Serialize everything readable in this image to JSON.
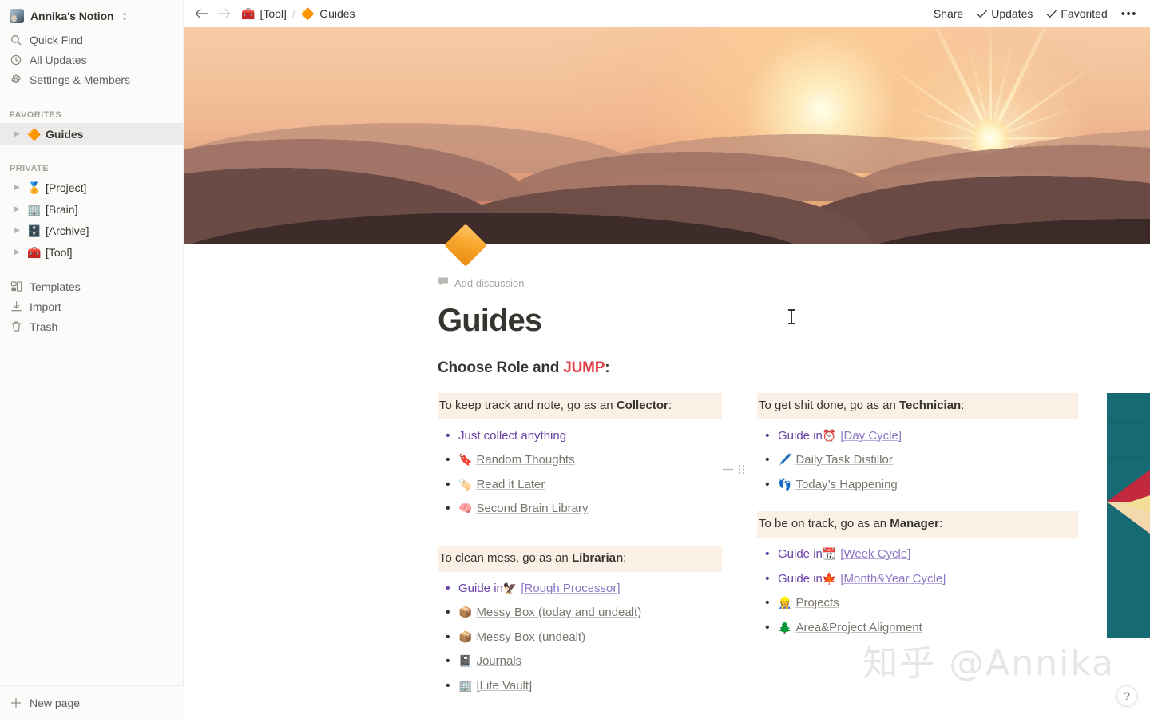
{
  "sidebar": {
    "workspace": {
      "name": "Annika's Notion",
      "avatar_icon": "user-avatar"
    },
    "nav": [
      {
        "label": "Quick Find",
        "icon": "search-icon"
      },
      {
        "label": "All Updates",
        "icon": "clock-icon"
      },
      {
        "label": "Settings & Members",
        "icon": "gear-icon"
      }
    ],
    "favorites_label": "FAVORITES",
    "favorites": [
      {
        "label": "Guides",
        "emoji": "🔶",
        "active": true
      }
    ],
    "private_label": "PRIVATE",
    "private": [
      {
        "label": "[Project]",
        "emoji": "🏅"
      },
      {
        "label": "[Brain]",
        "emoji": "🏢"
      },
      {
        "label": "[Archive]",
        "emoji": "🗄️"
      },
      {
        "label": "[Tool]",
        "emoji": "🧰"
      }
    ],
    "utilities": [
      {
        "label": "Templates",
        "icon": "templates-icon"
      },
      {
        "label": "Import",
        "icon": "import-icon"
      },
      {
        "label": "Trash",
        "icon": "trash-icon"
      }
    ],
    "new_page_label": "New page"
  },
  "topbar": {
    "back_icon": "arrow-left-icon",
    "forward_icon": "arrow-right-icon",
    "breadcrumb": [
      {
        "label": "[Tool]",
        "emoji": "🧰"
      },
      {
        "label": "Guides",
        "emoji": "🔶"
      }
    ],
    "separator": "/",
    "share_label": "Share",
    "updates_label": "Updates",
    "favorited_label": "Favorited",
    "more_label": "•••"
  },
  "page": {
    "icon_emoji": "🔶",
    "add_discussion_label": "Add discussion",
    "title": "Guides",
    "heading": {
      "prefix": "Choose Role and ",
      "accent": "JUMP",
      "suffix": ":"
    },
    "cover_alt": "sunset-mountain-cover"
  },
  "colors": {
    "callout_bg": "#faf0e6",
    "accent_red": "#e0404a",
    "purple_text": "#6940a5",
    "link_gray": "#79756e",
    "link_violet": "#8b77c4",
    "sidebar_bg": "#fbfbfa",
    "wall_teal": "#156a74",
    "arrow_red": "#c2293f",
    "arrow_yellow": "#f2dc96",
    "arrow_cream": "#f4d9ad",
    "page_icon_orange": "#f7a72c"
  },
  "sections": {
    "collector": {
      "callout_prefix": "To keep track and note, go as an ",
      "callout_role": "Collector",
      "callout_suffix": ":",
      "items": [
        {
          "text": "Just collect anything",
          "style": "purple-plain",
          "emoji": ""
        },
        {
          "text": "Random Thoughts",
          "style": "link",
          "emoji": "🔖"
        },
        {
          "text": "Read it Later",
          "style": "link",
          "emoji": "🏷️"
        },
        {
          "text": "Second Brain Library",
          "style": "link",
          "emoji": "🧠"
        }
      ]
    },
    "librarian": {
      "callout_prefix": "To clean mess, go as an ",
      "callout_role": "Librarian",
      "callout_suffix": ":",
      "items": [
        {
          "prefix": "Guide in ",
          "text": "[Rough Processor]",
          "style": "guide-link",
          "emoji": "🦅"
        },
        {
          "text": "Messy Box (today and undealt)",
          "style": "link",
          "emoji": "📦"
        },
        {
          "text": "Messy Box (undealt)",
          "style": "link",
          "emoji": "📦"
        },
        {
          "text": "Journals",
          "style": "link",
          "emoji": "📓"
        },
        {
          "text": "[Life Vault]",
          "style": "link",
          "emoji": "🏢"
        }
      ]
    },
    "technician": {
      "callout_prefix": "To get shit done, go as an ",
      "callout_role": "Technician",
      "callout_suffix": ":",
      "items": [
        {
          "prefix": "Guide in ",
          "text": "[Day Cycle]",
          "style": "guide-link",
          "emoji": "⏰"
        },
        {
          "text": "Daily Task Distillor",
          "style": "link",
          "emoji": "🖊️"
        },
        {
          "text": "Today’s Happening",
          "style": "link",
          "emoji": "👣"
        }
      ]
    },
    "manager": {
      "callout_prefix": "To be on track, go as an ",
      "callout_role": "Manager",
      "callout_suffix": ":",
      "items": [
        {
          "prefix": "Guide in ",
          "text": "[Week Cycle]",
          "style": "guide-link",
          "emoji": "📆"
        },
        {
          "prefix": "Guide in ",
          "text": "[Month&Year Cycle]",
          "style": "guide-link",
          "emoji": "🍁"
        },
        {
          "text": "Projects",
          "style": "link",
          "emoji": "👷"
        },
        {
          "text": "Area&Project Alignment",
          "style": "link",
          "emoji": "🌲"
        }
      ]
    }
  },
  "side_image": {
    "alt": "teal-wall-arrow-photo"
  },
  "watermark": {
    "text": "知乎 @Annika"
  },
  "help": {
    "label": "?"
  }
}
